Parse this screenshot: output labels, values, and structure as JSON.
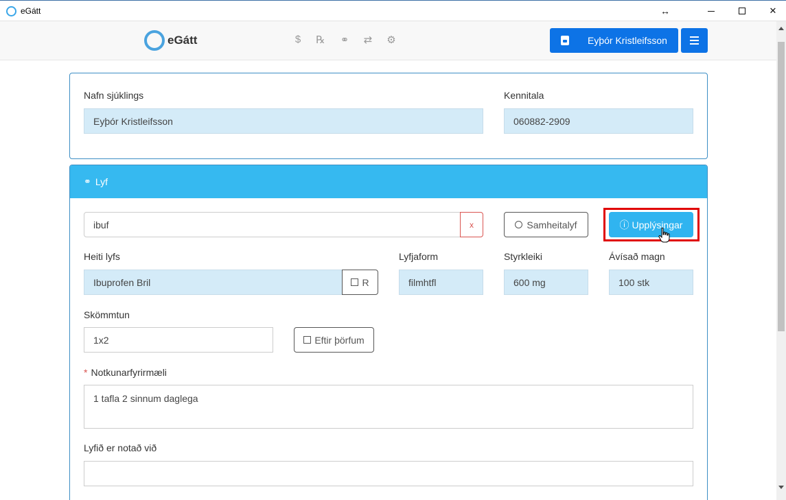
{
  "window": {
    "title": "eGátt",
    "resize_glyph": "↔",
    "close_glyph": "✕"
  },
  "navbar": {
    "logo_text": "eGátt",
    "icons": [
      {
        "name": "dollar-icon",
        "glyph": "$"
      },
      {
        "name": "prescription-icon",
        "glyph": "℞"
      },
      {
        "name": "pills-icon",
        "glyph": "⚭"
      },
      {
        "name": "exchange-icon",
        "glyph": "⇄"
      },
      {
        "name": "settings-icon",
        "glyph": "⚙"
      }
    ],
    "user_name": "Eyþór Kristleifsson"
  },
  "patient": {
    "name_label": "Nafn sjúklings",
    "name_value": "Eyþór Kristleifsson",
    "kennitala_label": "Kennitala",
    "kennitala_value": "060882-2909"
  },
  "lyf": {
    "header_icon": "⚭",
    "header_label": "Lyf",
    "search_value": "ibuf",
    "clear_label": "x",
    "samheitalyf_label": "Samheitalyf",
    "upplysingar_icon": "ⓘ",
    "upplysingar_label": "Upplýsingar",
    "heiti_label": "Heiti lyfs",
    "heiti_value": "Ibuprofen Bril",
    "r_label": "R",
    "lyfjaform_label": "Lyfjaform",
    "lyfjaform_value": "filmhtfl",
    "styrkleiki_label": "Styrkleiki",
    "styrkleiki_value": "600 mg",
    "magn_label": "Ávísað magn",
    "magn_value": "100 stk",
    "skommtun_label": "Skömmtun",
    "skommtun_value": "1x2",
    "eftir_label": "Eftir þörfum",
    "notkun_star": "*",
    "notkun_label": "Notkunarfyrirmæli",
    "notkun_value": "1 tafla 2 sinnum daglega",
    "notad_label": "Lyfið er notað við",
    "notad_value": ""
  },
  "colors": {
    "primary": "#0d73e6",
    "info": "#30b4f0",
    "header": "#36b9f0",
    "readonly_bg": "#d4ebf8",
    "highlight": "#e00000"
  }
}
